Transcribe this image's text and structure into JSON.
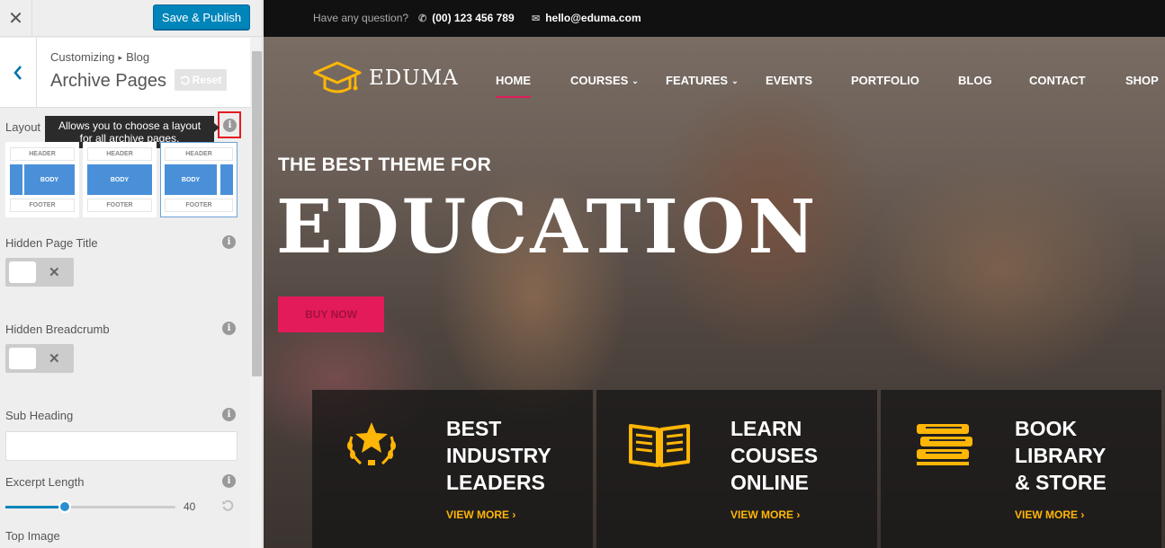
{
  "sidebar": {
    "close_label": "✕",
    "publish_label": "Save & Publish",
    "breadcrumb_parent": "Customizing",
    "breadcrumb_arrow": "▸",
    "breadcrumb_current": "Blog",
    "section_title": "Archive Pages",
    "reset_label": "Reset",
    "layout": {
      "label": "Layout",
      "tooltip_line1": "Allows you to choose a layout",
      "tooltip_line2": "for all archive pages.",
      "options": [
        {
          "header": "HEADER",
          "body": "BODY",
          "footer": "FOOTER",
          "sidebar": "left"
        },
        {
          "header": "HEADER",
          "body": "BODY",
          "footer": "FOOTER",
          "sidebar": "none"
        },
        {
          "header": "HEADER",
          "body": "BODY",
          "footer": "FOOTER",
          "sidebar": "right"
        }
      ],
      "selected_index": 2
    },
    "hidden_page_title": {
      "label": "Hidden Page Title",
      "state": "✕"
    },
    "hidden_breadcrumb": {
      "label": "Hidden Breadcrumb",
      "state": "✕"
    },
    "sub_heading": {
      "label": "Sub Heading",
      "value": ""
    },
    "excerpt_length": {
      "label": "Excerpt Length",
      "value": "40",
      "fraction": 0.35
    },
    "top_image": {
      "label": "Top Image"
    }
  },
  "preview": {
    "topbar": {
      "question": "Have any question?",
      "phone": "(00) 123 456 789",
      "email": "hello@eduma.com"
    },
    "logo": "EDUMA",
    "nav": [
      {
        "label": "HOME"
      },
      {
        "label": "COURSES"
      },
      {
        "label": "FEATURES"
      },
      {
        "label": "EVENTS"
      },
      {
        "label": "PORTFOLIO"
      },
      {
        "label": "BLOG"
      },
      {
        "label": "CONTACT"
      },
      {
        "label": "SHOP"
      }
    ],
    "hero": {
      "subtitle": "THE BEST THEME FOR",
      "title": "EDUCATION",
      "button": "BUY NOW"
    },
    "features": [
      {
        "line1": "BEST",
        "line2": "INDUSTRY",
        "line3": "LEADERS",
        "more": "VIEW MORE ›"
      },
      {
        "line1": "LEARN",
        "line2": "COUSES",
        "line3": "ONLINE",
        "more": "VIEW MORE ›"
      },
      {
        "line1": "BOOK",
        "line2": "LIBRARY",
        "line3": "& STORE",
        "more": "VIEW MORE ›"
      }
    ]
  },
  "colors": {
    "accent": "#e31b5a",
    "publish": "#0085ba",
    "highlight": "#ffb606"
  }
}
